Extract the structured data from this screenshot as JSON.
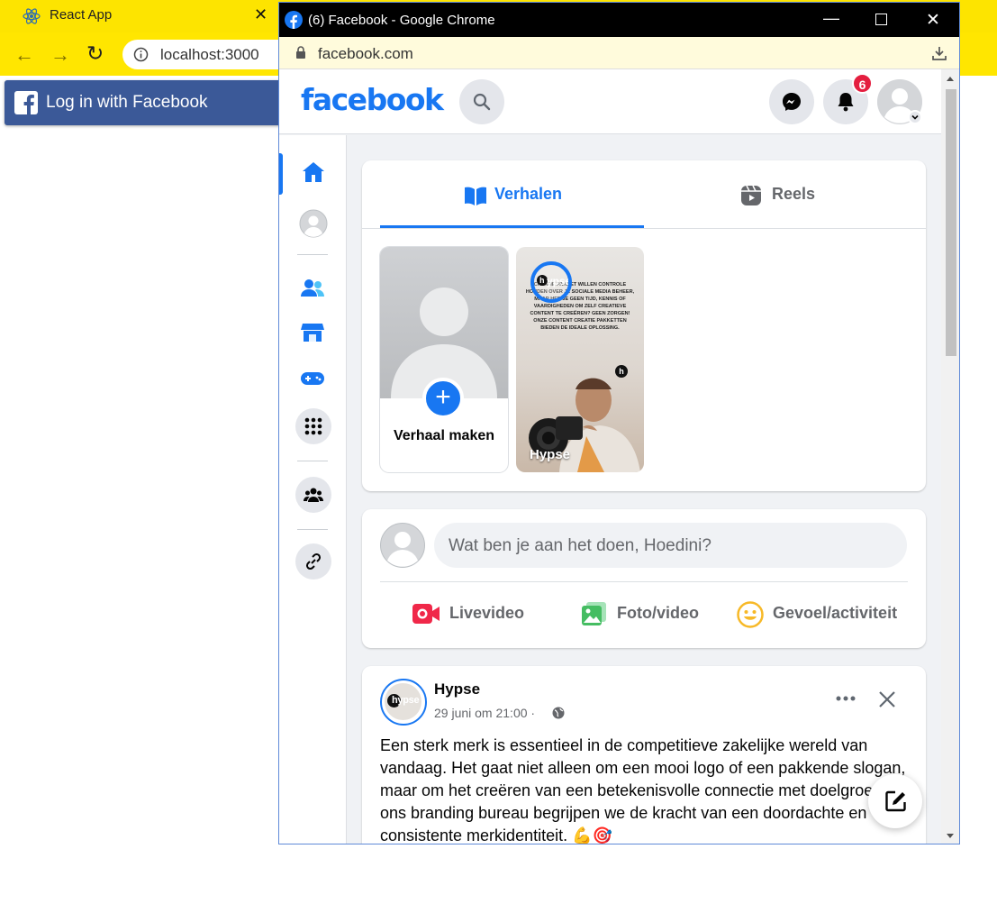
{
  "react_window": {
    "tab_title": "React App",
    "url": "localhost:3000",
    "login_button_label": "Log in with Facebook"
  },
  "popup": {
    "window_title": "(6) Facebook - Google Chrome",
    "url": "facebook.com"
  },
  "facebook": {
    "logo": "facebook",
    "notification_count": "6",
    "stories_tab": "Verhalen",
    "reels_tab": "Reels",
    "create_story_label": "Verhaal maken",
    "story_author": "Hypse",
    "story_text": "CREATIE PAKKET WILLEN CONTROLE HOUDEN OVER JE SOCIALE MEDIA BEHEER, MAAR HEB JE GEEN TIJD, KENNIS OF VAARDIGHEDEN OM ZELF CREATIEVE CONTENT TE CREËREN? GEEN ZORGEN! ONZE CONTENT CREATIE PAKKETTEN BIEDEN DE IDEALE OPLOSSING.",
    "composer_placeholder": "Wat ben je aan het doen, Hoedini?",
    "actions": {
      "live": "Livevideo",
      "photo": "Foto/video",
      "feeling": "Gevoel/activiteit"
    },
    "post": {
      "author": "Hypse",
      "meta": "29 juni om 21:00 ·",
      "text": "Een sterk merk is essentieel in de competitieve zakelijke wereld van vandaag. Het gaat niet alleen om een mooi logo of een pakkende slogan, maar om het creëren van een betekenisvolle connectie met doelgroep. Bij ons branding bureau begrijpen we de kracht van een doordachte en consistente merkidentiteit. 💪🎯",
      "avatar_text": "hypse"
    }
  },
  "colors": {
    "fb_blue": "#1877f2",
    "react_yellow": "#fde400",
    "login_blue": "#3b5998"
  }
}
